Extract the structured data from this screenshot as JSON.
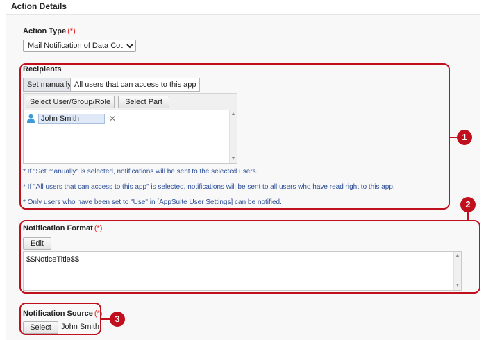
{
  "section": {
    "title": "Action Details"
  },
  "action_type": {
    "label": "Action Type",
    "required_mark": "(*)",
    "selected": "Mail Notification of Data Count"
  },
  "recipients": {
    "label": "Recipients",
    "tabs": [
      {
        "label": "Set manually",
        "active": true
      },
      {
        "label": "All users that can access to this app",
        "active": false
      }
    ],
    "buttons": {
      "select_user": "Select User/Group/Role",
      "select_part": "Select Part"
    },
    "selected_users": [
      {
        "name": "John Smith",
        "icon": "user-icon"
      }
    ],
    "notes": [
      "* If \"Set manually\" is selected, notifications will be sent to the selected users.",
      "* If \"All users that can access to this app\" is selected, notifications will be sent to all users who have read right to this app.",
      "* Only users who have been set to \"Use\" in [AppSuite User Settings] can be notified."
    ]
  },
  "notification_format": {
    "label": "Notification Format",
    "required_mark": "(*)",
    "edit_label": "Edit",
    "value": "$$NoticeTitle$$"
  },
  "notification_source": {
    "label": "Notification Source",
    "required_mark": "(*)",
    "select_label": "Select",
    "value": "John Smith"
  },
  "callouts": [
    "1",
    "2",
    "3"
  ],
  "colors": {
    "callout": "#c0101e",
    "note_text": "#2d4f96",
    "required": "#e0201c"
  }
}
